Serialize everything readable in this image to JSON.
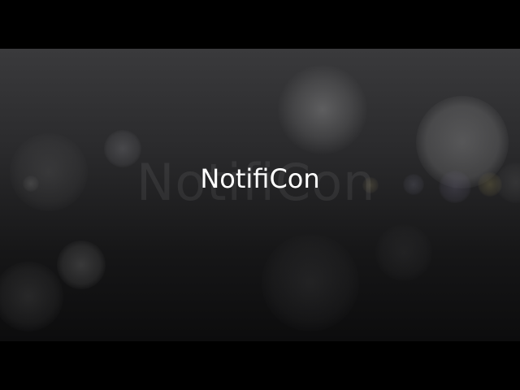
{
  "title": "NotifiCon",
  "ghost_title": "NotifiCon",
  "colors": {
    "background_top": "#3a3a3c",
    "background_bottom": "#0c0c0d",
    "letterbox": "#000000",
    "title_text": "#ffffff"
  }
}
